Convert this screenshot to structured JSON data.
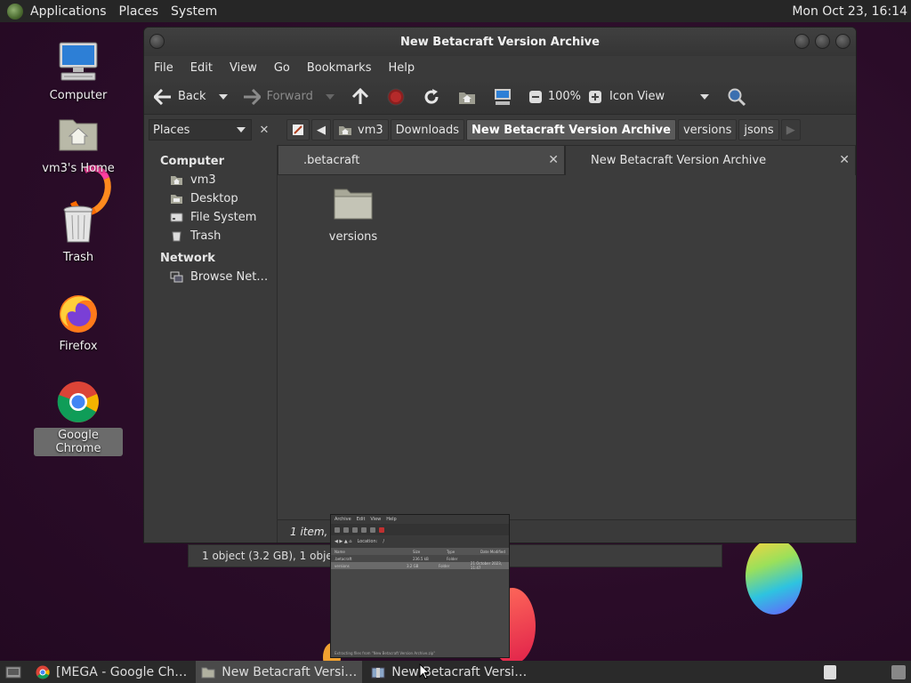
{
  "top_panel": {
    "menu": [
      "Applications",
      "Places",
      "System"
    ],
    "clock": "Mon Oct 23, 16:14"
  },
  "desktop": {
    "icons": [
      {
        "label": "Computer",
        "icon": "computer-icon"
      },
      {
        "label": "vm3's Home",
        "icon": "home-folder-icon"
      },
      {
        "label": "Trash",
        "icon": "trash-icon"
      },
      {
        "label": "Firefox",
        "icon": "firefox-icon"
      },
      {
        "label": "Google Chrome",
        "icon": "chrome-icon",
        "selected": true
      }
    ]
  },
  "window": {
    "title": "New Betacraft Version Archive",
    "menubar": [
      "File",
      "Edit",
      "View",
      "Go",
      "Bookmarks",
      "Help"
    ],
    "toolbar": {
      "back": "Back",
      "forward": "Forward",
      "zoom": "100%",
      "view_mode": "Icon View"
    },
    "places": {
      "combo_label": "Places",
      "sections": [
        {
          "heading": "Computer",
          "items": [
            "vm3",
            "Desktop",
            "File System",
            "Trash"
          ]
        },
        {
          "heading": "Network",
          "items": [
            "Browse Net…"
          ]
        }
      ]
    },
    "breadcrumbs": [
      "vm3",
      "Downloads",
      "New Betacraft Version Archive",
      "versions",
      "jsons"
    ],
    "tabs": [
      {
        "label": ".betacraft",
        "active": false
      },
      {
        "label": "New Betacraft Version Archive",
        "active": true
      }
    ],
    "items": [
      {
        "name": "versions",
        "type": "folder"
      }
    ],
    "status": "1 item, F"
  },
  "background_window": {
    "status": "1 object (3.2 GB), 1 object selec"
  },
  "preview": {
    "menu": [
      "Archive",
      "Edit",
      "View",
      "Help"
    ],
    "location": "Location:",
    "columns": [
      "Name",
      "Size",
      "Type",
      "Date Modified"
    ],
    "rows": [
      {
        "name": ".betacraft",
        "size": "236.5 kB",
        "type": "Folder",
        "date": ""
      },
      {
        "name": "versions",
        "size": "3.2 GB",
        "type": "Folder",
        "date": "21 October 2023, 11:47"
      }
    ],
    "status": "Extracting files from \"New Betacraft Version Archive.zip\""
  },
  "taskbar": {
    "tasks": [
      {
        "label": "[MEGA - Google Ch…",
        "icon": "chrome-icon",
        "active": false
      },
      {
        "label": "New Betacraft Versi…",
        "icon": "folder-icon",
        "active": true
      },
      {
        "label": "New Betacraft Versi…",
        "icon": "archive-icon",
        "active": false
      }
    ]
  }
}
